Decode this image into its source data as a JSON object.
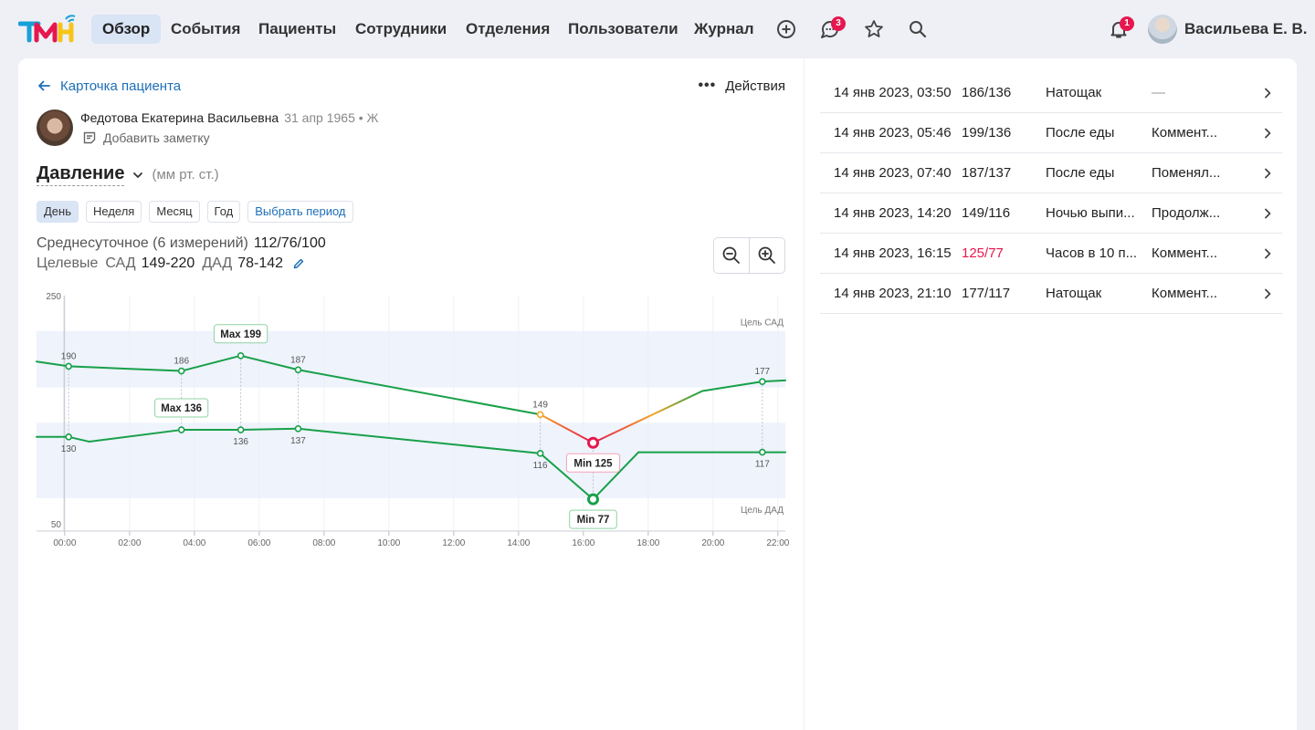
{
  "nav": {
    "items": [
      {
        "label": "Обзор",
        "active": true
      },
      {
        "label": "События",
        "active": false
      },
      {
        "label": "Пациенты",
        "active": false
      },
      {
        "label": "Сотрудники",
        "active": false
      },
      {
        "label": "Отделения",
        "active": false
      },
      {
        "label": "Пользователи",
        "active": false
      },
      {
        "label": "Журнал",
        "active": false
      }
    ],
    "icons": [
      "plus-circle-icon",
      "chat-icon",
      "star-icon",
      "search-icon"
    ],
    "chat_badge": "3",
    "notifications_badge": "1",
    "user_name": "Васильева Е. В."
  },
  "header": {
    "back_label": "Карточка пациента",
    "actions_label": "Действия"
  },
  "patient": {
    "name": "Федотова Екатерина Васильевна",
    "meta": "31 апр 1965 • Ж",
    "add_note": "Добавить заметку"
  },
  "metric": {
    "title": "Давление",
    "unit": "(мм рт. ст.)",
    "periods": [
      "День",
      "Неделя",
      "Месяц",
      "Год",
      "Выбрать период"
    ],
    "active_period": "День",
    "avg_label": "Среднесуточное (6 измерений)",
    "avg_value": "112/76/100",
    "target_label": "Целевые",
    "sad_label": "САД",
    "sad_value": "149-220",
    "dad_label": "ДАД",
    "dad_value": "78-142"
  },
  "colors": {
    "accent": "#1d6fb8",
    "series_green": "#18a049",
    "alert_red": "#e6174e",
    "warning_orange": "#f5a623",
    "target_band": "#eef3fc"
  },
  "chart_data": {
    "type": "line",
    "y_ticks": [
      "250",
      "50"
    ],
    "ylim": [
      50,
      250
    ],
    "x_ticks": [
      "00:00",
      "02:00",
      "04:00",
      "06:00",
      "08:00",
      "10:00",
      "12:00",
      "14:00",
      "16:00",
      "18:00",
      "20:00",
      "22:00"
    ],
    "xlim_hours": [
      -0.87,
      22.23
    ],
    "target_sad_label": "Цель САД",
    "target_dad_label": "Цель ДАД",
    "series": [
      {
        "key": "sad",
        "points": [
          {
            "t": -0.87,
            "v": 194
          },
          {
            "t": 0.12,
            "v": 190,
            "label": "190"
          },
          {
            "t": 3.6,
            "v": 186,
            "label": "186"
          },
          {
            "t": 5.43,
            "v": 199,
            "label": "Max 199",
            "tag": true
          },
          {
            "t": 7.2,
            "v": 187,
            "label": "187"
          },
          {
            "t": 14.67,
            "v": 149,
            "label": "149",
            "warn": true
          },
          {
            "t": 16.3,
            "v": 125,
            "label": "Min 125",
            "tag": true,
            "alert": true
          },
          {
            "t": 19.67,
            "v": 169
          },
          {
            "t": 21.52,
            "v": 177,
            "label": "177"
          },
          {
            "t": 22.23,
            "v": 178
          }
        ]
      },
      {
        "key": "dad",
        "points": [
          {
            "t": -0.87,
            "v": 130
          },
          {
            "t": 0.12,
            "v": 130,
            "label": "130"
          },
          {
            "t": 0.75,
            "v": 126
          },
          {
            "t": 3.6,
            "v": 136,
            "label": "Max 136",
            "tag": true
          },
          {
            "t": 5.43,
            "v": 136,
            "label": "136"
          },
          {
            "t": 7.2,
            "v": 137,
            "label": "137"
          },
          {
            "t": 14.67,
            "v": 116,
            "label": "116"
          },
          {
            "t": 16.3,
            "v": 77,
            "label": "Min 77",
            "tag": true
          },
          {
            "t": 17.7,
            "v": 117
          },
          {
            "t": 21.52,
            "v": 117,
            "label": "117"
          },
          {
            "t": 22.23,
            "v": 117
          }
        ]
      }
    ]
  },
  "measurements": [
    {
      "time": "14 янв 2023, 03:50",
      "value": "186/136",
      "context": "Натощак",
      "comment": "—",
      "alert": false
    },
    {
      "time": "14 янв 2023, 05:46",
      "value": "199/136",
      "context": "После еды",
      "comment": "Коммент...",
      "alert": false
    },
    {
      "time": "14 янв 2023, 07:40",
      "value": "187/137",
      "context": "После еды",
      "comment": "Поменял...",
      "alert": false
    },
    {
      "time": "14 янв 2023, 14:20",
      "value": "149/116",
      "context": "Ночью выпи...",
      "comment": "Продолж...",
      "alert": false
    },
    {
      "time": "14 янв 2023, 16:15",
      "value": "125/77",
      "context": "Часов в 10 п...",
      "comment": "Коммент...",
      "alert": true
    },
    {
      "time": "14 янв 2023, 21:10",
      "value": "177/117",
      "context": "Натощак",
      "comment": "Коммент...",
      "alert": false
    }
  ]
}
